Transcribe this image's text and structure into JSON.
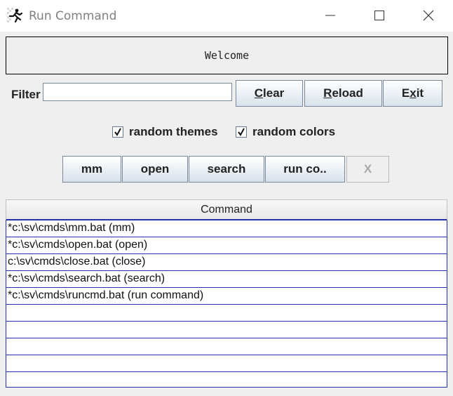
{
  "window": {
    "title": "Run Command"
  },
  "banner": {
    "text": "Welcome"
  },
  "filter": {
    "label": "Filter",
    "value": "",
    "placeholder": ""
  },
  "toolbar": {
    "clear": {
      "mnemonic": "C",
      "rest": "lear"
    },
    "reload": {
      "mnemonic": "R",
      "rest": "eload"
    },
    "exit": {
      "pre": "E",
      "mnemonic": "x",
      "rest": "it"
    }
  },
  "options": {
    "random_themes": {
      "label": "random themes",
      "checked": true
    },
    "random_colors": {
      "label": "random colors",
      "checked": true
    }
  },
  "quick_buttons": {
    "mm": "mm",
    "open": "open",
    "search": "search",
    "run": "run co..",
    "x": "X"
  },
  "table": {
    "header": "Command",
    "rows": [
      "*c:\\sv\\cmds\\mm.bat (mm)",
      "*c:\\sv\\cmds\\open.bat (open)",
      "c:\\sv\\cmds\\close.bat (close)",
      "*c:\\sv\\cmds\\search.bat (search)",
      "*c:\\sv\\cmds\\runcmd.bat (run command)",
      "",
      "",
      "",
      "",
      ""
    ]
  },
  "icons": {
    "app": "running-man-icon",
    "minimize": "minimize-icon",
    "maximize": "maximize-icon",
    "close": "close-icon",
    "check": "checkmark-icon"
  },
  "colors": {
    "grid_line": "#2433a8",
    "background": "#efefef"
  }
}
